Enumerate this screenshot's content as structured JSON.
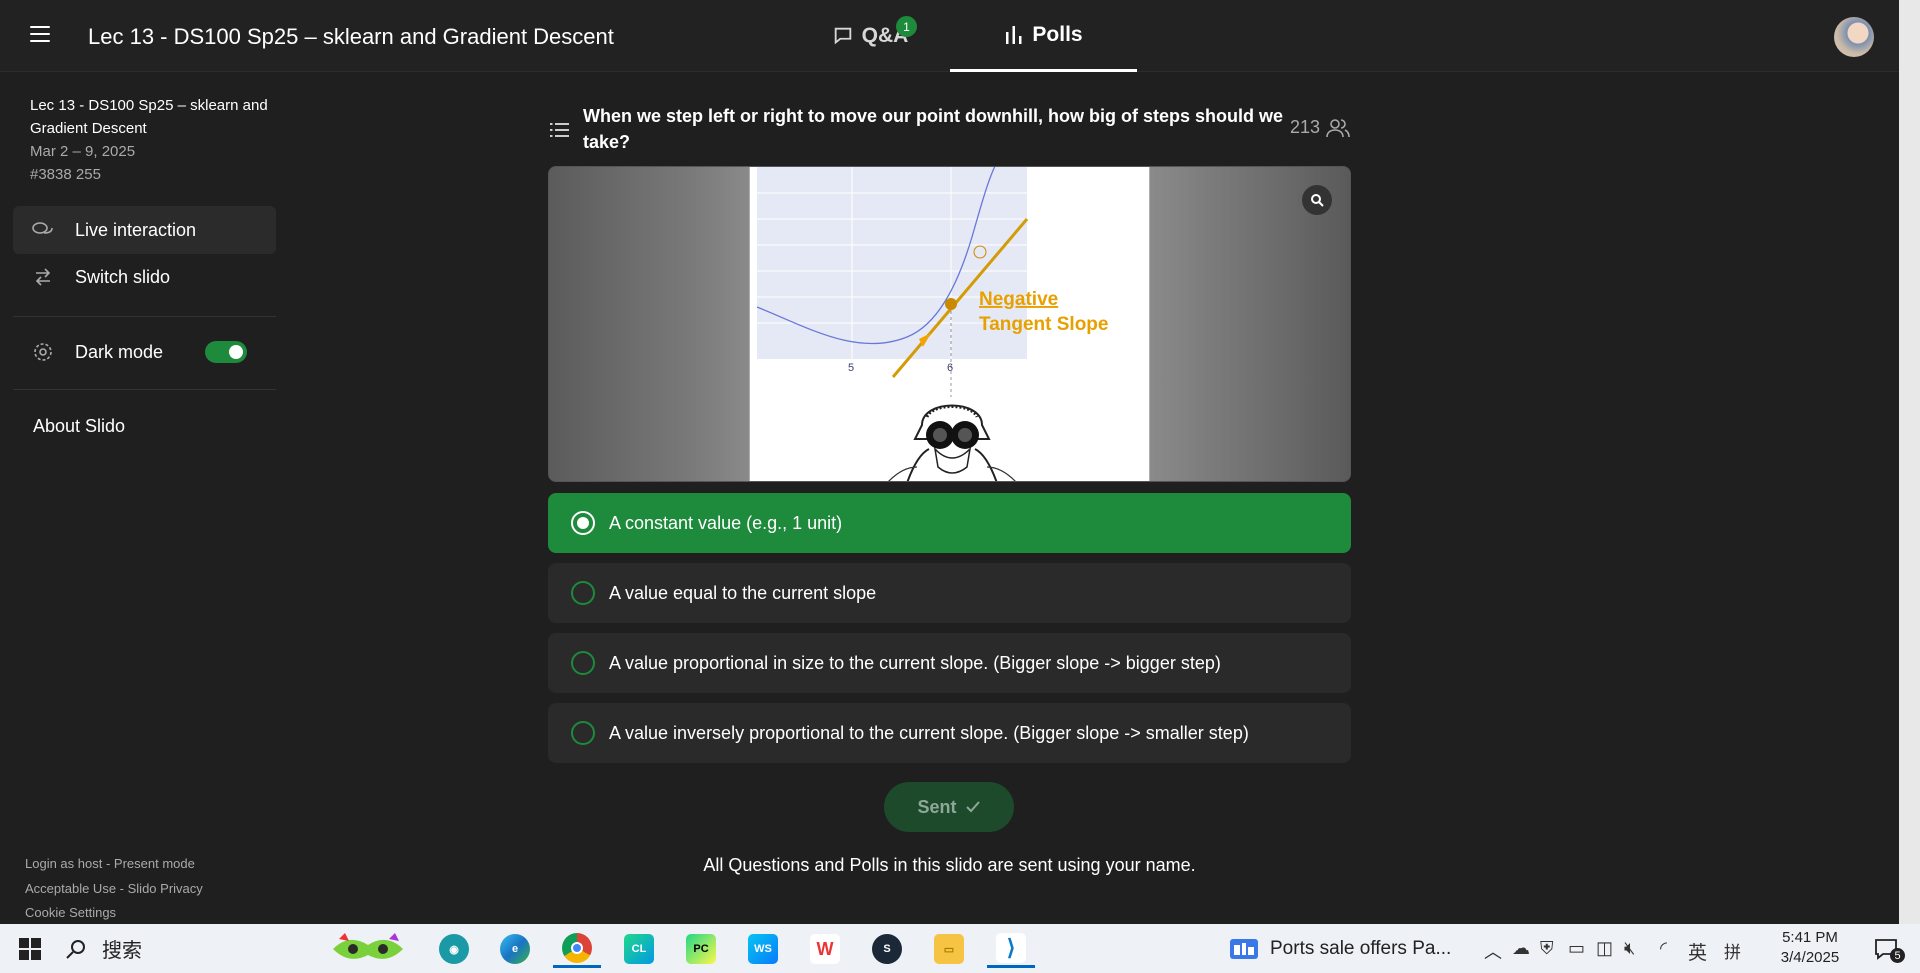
{
  "header": {
    "event_title": "Lec 13 - DS100 Sp25 – sklearn and Gradient Descent",
    "tabs": {
      "qa": "Q&A",
      "qa_badge": "1",
      "polls": "Polls"
    }
  },
  "sidebar": {
    "event_title": "Lec 13 - DS100 Sp25 – sklearn and Gradient Descent",
    "dates": "Mar 2 – 9, 2025",
    "code": "#3838 255",
    "items": {
      "live": "Live interaction",
      "switch": "Switch slido",
      "dark_mode": "Dark mode",
      "about": "About Slido"
    },
    "dark_mode_on": true,
    "footer": {
      "login": "Login as host",
      "present": "Present mode",
      "acceptable": "Acceptable Use",
      "privacy": "Slido Privacy",
      "cookie": "Cookie Settings",
      "sep": " - "
    }
  },
  "poll": {
    "question": "When we step left or right to move our point downhill, how big of steps should we take?",
    "participants": "213",
    "slide": {
      "label_line1": "Negative",
      "label_line2": "Tangent Slope",
      "tick_5": "5",
      "tick_6": "6"
    },
    "options": [
      {
        "label": "A constant value (e.g., 1 unit)",
        "selected": true
      },
      {
        "label": "A value equal to the current slope",
        "selected": false
      },
      {
        "label": "A value proportional in size to the current slope. (Bigger slope -> bigger step)",
        "selected": false
      },
      {
        "label": "A value inversely proportional to the current slope. (Bigger slope -> smaller step)",
        "selected": false
      }
    ],
    "sent_label": "Sent",
    "note": "All Questions and Polls in this slido are sent using your name."
  },
  "taskbar": {
    "search_label": "搜索",
    "news": "Ports sale offers Pa...",
    "ime_lang": "英",
    "ime_mode": "拼",
    "time": "5:41 PM",
    "date": "3/4/2025",
    "notification_count": "5"
  },
  "colors": {
    "accent_green": "#1d8a3c",
    "background": "#1f1f1f",
    "option_bg": "#2a2a2a",
    "slide_orange": "#e8a000"
  }
}
